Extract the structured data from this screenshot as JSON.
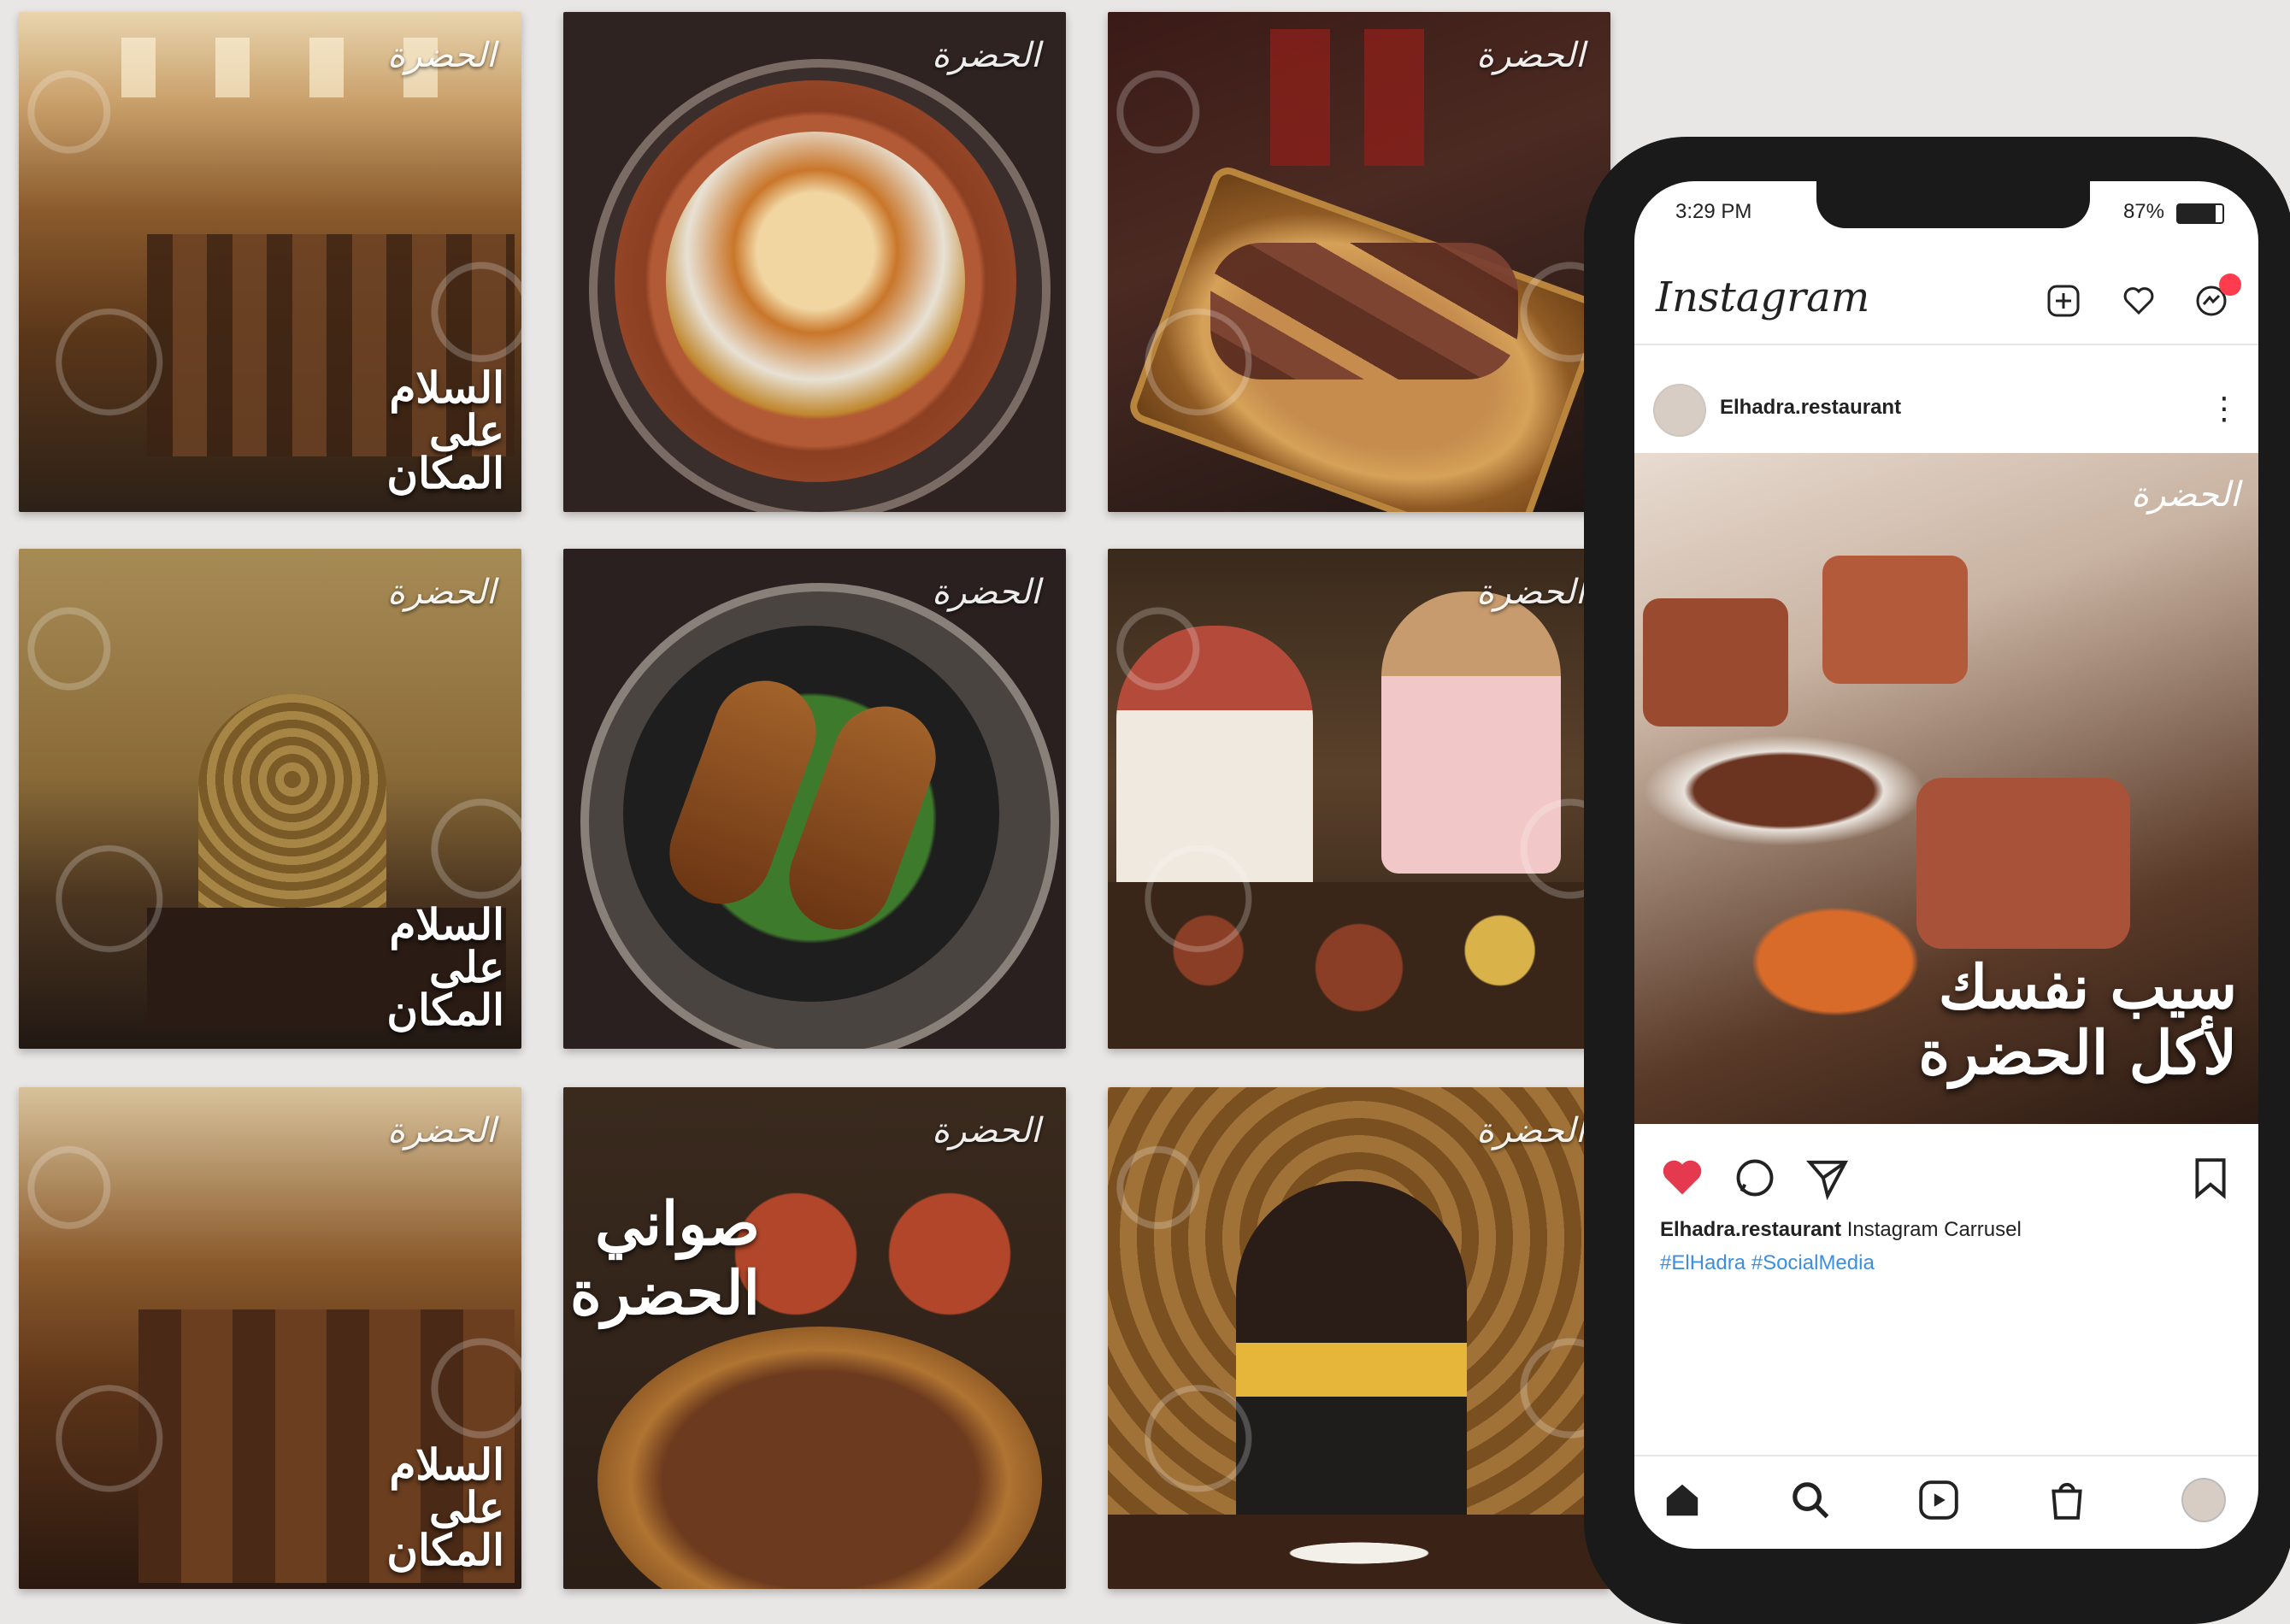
{
  "tiles": {
    "logo_text": "الحضرة",
    "slogan_text": "السلام على المكان",
    "soup_title": "صواني الحضرة"
  },
  "phone": {
    "status_time": "3:29 PM",
    "status_battery": "87%",
    "app_name": "Instagram",
    "username": "Elhadra.restaurant",
    "post_headline_line1": "سيب نفسك",
    "post_headline_line2": "لأكل الحضرة",
    "caption_user": "Elhadra.restaurant",
    "caption_text": "Instagram Carrusel",
    "hashtags": "#ElHadra #SocialMedia"
  },
  "colors": {
    "like_red": "#e53950",
    "hashtag_blue": "#3a8fe0",
    "notification_dot": "#ff3b4e"
  },
  "icons": {
    "header": [
      "new-post-icon",
      "heart-icon",
      "messenger-icon"
    ],
    "actions": [
      "like-heart-icon",
      "comment-icon",
      "share-icon",
      "bookmark-icon"
    ],
    "nav": [
      "home-icon",
      "search-icon",
      "reels-icon",
      "shop-icon",
      "profile-avatar-icon"
    ]
  }
}
